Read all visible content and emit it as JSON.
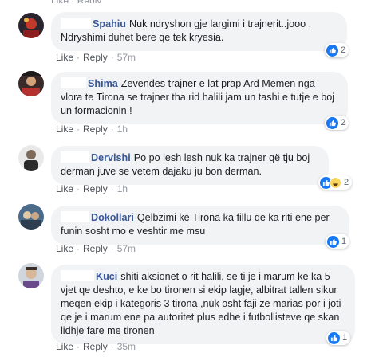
{
  "labels": {
    "like": "Like",
    "reply": "Reply",
    "sep": "·"
  },
  "comments": [
    {
      "author": "Spahiu",
      "text": "Nuk ndryshon gje largimi i trajnerit..jooo . Ndryshimi duhet bere qe tek kryesia.",
      "time": "57m",
      "reaction_count": "2",
      "reactions": [
        "like-icon"
      ]
    },
    {
      "author": "Shima",
      "text": "Zevendes trajner e lat prap Ard Memen nga vlora te Tirona se trajner tha rid halili jam un tashi e tutje e boj un formacionin !",
      "time": "1h",
      "reaction_count": "2",
      "reactions": [
        "like-icon"
      ]
    },
    {
      "author": "Dervishi",
      "text": "Po po lesh lesh nuk ka trajner që tju boj derman juve se vetem dajaku ju bon derman.",
      "time": "1h",
      "reaction_count": "2",
      "reactions": [
        "like-icon",
        "haha-icon"
      ]
    },
    {
      "author": "Dokollari",
      "text": "Qelbzimi ke Tirona ka fillu qe ka riti ene per funin sosht mo e veshtir me msu",
      "time": "57m",
      "reaction_count": "1",
      "reactions": [
        "like-icon"
      ]
    },
    {
      "author": "Kuci",
      "text": "shiti aksionet o rit halili, se ti je i marum ke ka 5 vjet qe deshto, e ke bo tironen si ekip lagje, albitrat tallen sikur meqen ekip i kategoris 3 tirona ,nuk osht faji ze marias por i joti qe je i marum ene pa autoritet plus edhe i futbollisteve qe skan lidhje fare me tironen",
      "time": "35m",
      "reaction_count": "1",
      "reactions": [
        "like-icon"
      ]
    }
  ],
  "colors": {
    "author": "#385898",
    "bubble": "#f2f3f5",
    "like_blue": "#1877f2",
    "haha_yellow": "#fcd65a",
    "meta_text": "#606770"
  }
}
